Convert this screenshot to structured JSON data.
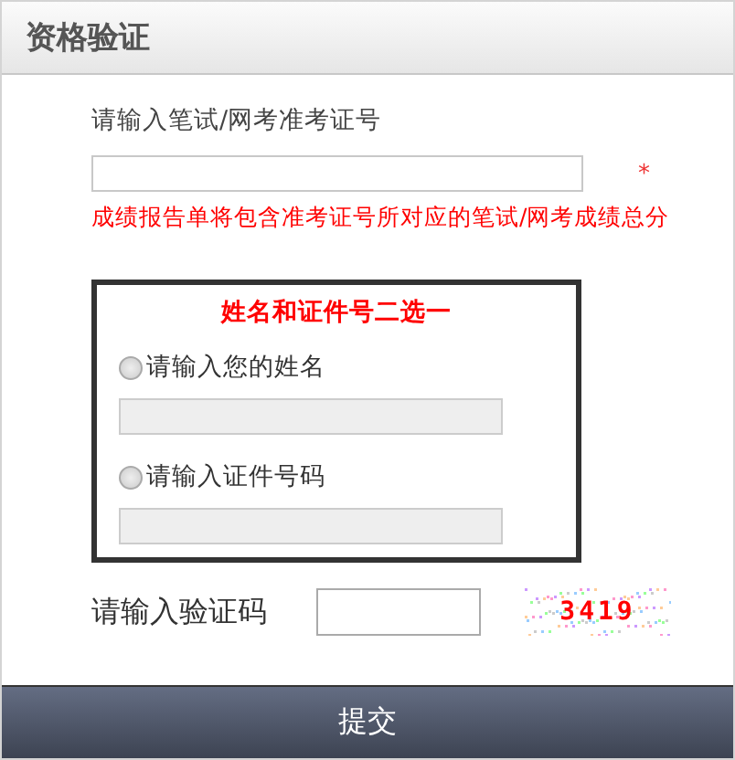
{
  "panel": {
    "title": "资格验证"
  },
  "ticket": {
    "label": "请输入笔试/网考准考证号",
    "required_mark": "*",
    "note": "成绩报告单将包含准考证号所对应的笔试/网考成绩总分"
  },
  "choice": {
    "title": "姓名和证件号二选一",
    "options": [
      {
        "label": "请输入您的姓名",
        "selected": false
      },
      {
        "label": "请输入证件号码",
        "selected": false
      }
    ]
  },
  "captcha": {
    "label": "请输入验证码",
    "code": "3419"
  },
  "submit": {
    "label": "提交"
  }
}
